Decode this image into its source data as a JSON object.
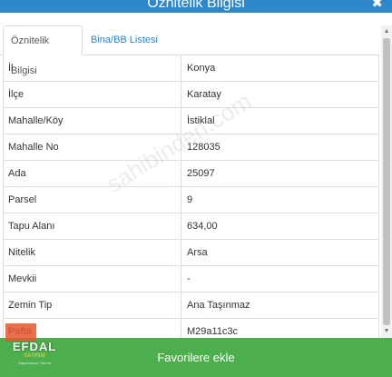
{
  "window": {
    "title": "Öznitelik Bilgisi",
    "close_glyph": "✖"
  },
  "tabs": [
    {
      "label": "Öznitelik Bilgisi",
      "active": true
    },
    {
      "label": "Bina/BB Listesi",
      "active": false
    }
  ],
  "attributes": [
    {
      "key": "İl",
      "value": "Konya"
    },
    {
      "key": "İlçe",
      "value": "Karatay"
    },
    {
      "key": "Mahalle/Köy",
      "value": "İstiklal"
    },
    {
      "key": "Mahalle No",
      "value": "128035"
    },
    {
      "key": "Ada",
      "value": "25097"
    },
    {
      "key": "Parsel",
      "value": "9"
    },
    {
      "key": "Tapu Alanı",
      "value": "634,00"
    },
    {
      "key": "Nitelik",
      "value": "Arsa"
    },
    {
      "key": "Mevkii",
      "value": "-"
    },
    {
      "key": "Zemin Tip",
      "value": "Ana Taşınmaz"
    },
    {
      "key": "Pafta",
      "value": "M29a11c3c"
    }
  ],
  "footer": {
    "favorite_label": "Favorilere ekle"
  },
  "watermark": {
    "text": "sahibinden.com"
  },
  "logo": {
    "name": "EFDAL",
    "subtitle": "YATIRIM",
    "tagline": "Gayrimenkul Yatırım"
  },
  "colors": {
    "header": "#2f86c8",
    "tab_link": "#2f86c8",
    "favorite_bar": "#4cae4c",
    "border": "#dddddd"
  },
  "scrollbar": {
    "up_glyph": "▲",
    "down_glyph": "▼"
  }
}
